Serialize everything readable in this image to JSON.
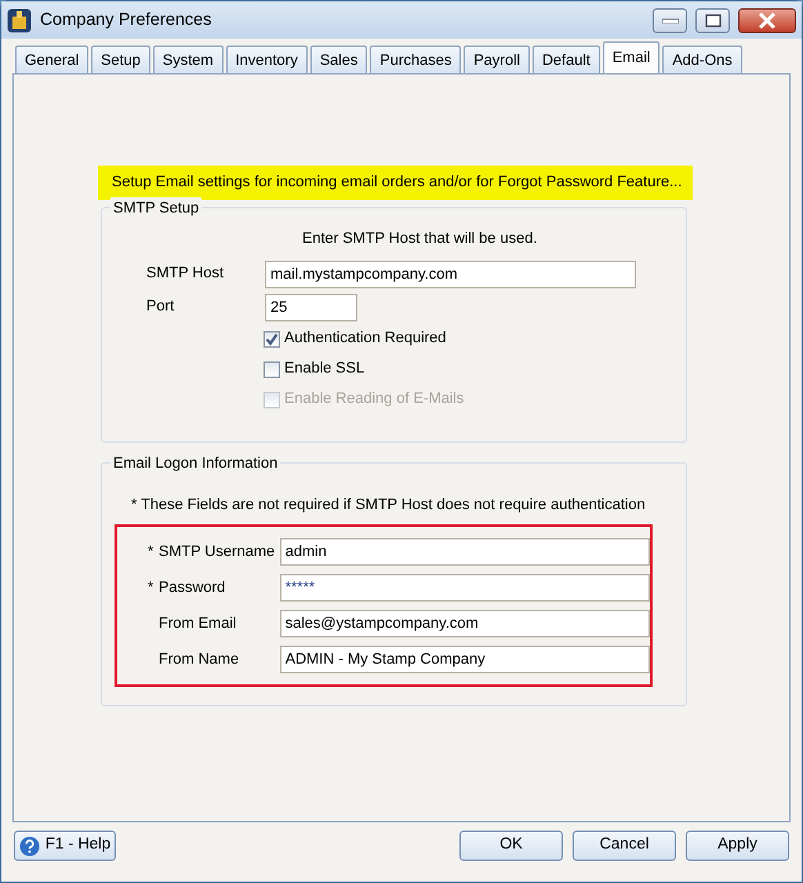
{
  "window": {
    "title": "Company Preferences"
  },
  "tabs": [
    {
      "label": "General",
      "selected": false
    },
    {
      "label": "Setup",
      "selected": false
    },
    {
      "label": "System",
      "selected": false
    },
    {
      "label": "Inventory",
      "selected": false
    },
    {
      "label": "Sales",
      "selected": false
    },
    {
      "label": "Purchases",
      "selected": false
    },
    {
      "label": "Payroll",
      "selected": false
    },
    {
      "label": "Default",
      "selected": false
    },
    {
      "label": "Email",
      "selected": true
    },
    {
      "label": "Add-Ons",
      "selected": false
    }
  ],
  "notice": "Setup Email settings for incoming email orders and/or for Forgot Password Feature...",
  "smtp_setup": {
    "title": "SMTP Setup",
    "hint": "Enter SMTP Host that will be used.",
    "fields": [
      {
        "label": "SMTP Host",
        "value": "mail.mystampcompany.com",
        "kind": "wide"
      },
      {
        "label": "Port",
        "value": "25",
        "kind": "short"
      }
    ],
    "options": [
      {
        "label": "Authentication Required",
        "checked": true,
        "disabled": false
      },
      {
        "label": "Enable SSL",
        "checked": false,
        "disabled": false
      },
      {
        "label": "Enable Reading of E-Mails",
        "checked": false,
        "disabled": true
      }
    ]
  },
  "email_logon": {
    "title": "Email Logon Information",
    "note": "* These Fields are not required if SMTP Host does not require authentication",
    "fields": [
      {
        "marker": "*",
        "label": "SMTP Username",
        "value": "admin",
        "kind": "text"
      },
      {
        "marker": "*",
        "label": "Password",
        "value": "*****",
        "kind": "masked"
      },
      {
        "label": "From Email",
        "value": "sales@ystampcompany.com",
        "kind": "text"
      },
      {
        "label": "From Name",
        "value": "ADMIN - My Stamp Company",
        "kind": "text"
      }
    ]
  },
  "footer": {
    "help": "F1 - Help",
    "buttons": [
      "OK",
      "Cancel",
      "Apply"
    ]
  }
}
